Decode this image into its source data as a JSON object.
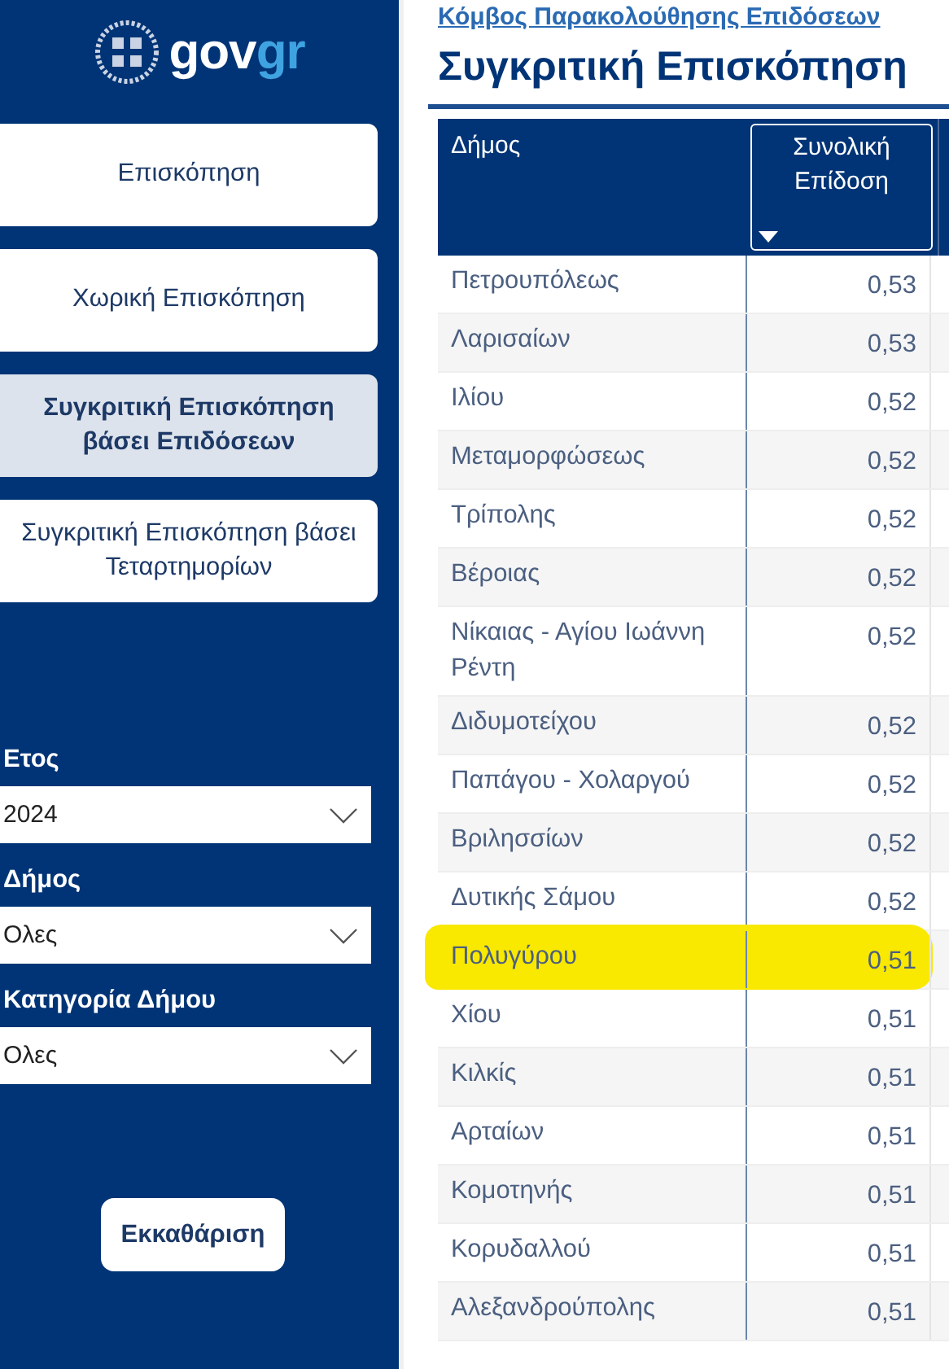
{
  "sidebar": {
    "logo": {
      "part_1": "gov",
      "part_2": "gr"
    },
    "nav": [
      {
        "label": "Επισκόπηση",
        "selected": false
      },
      {
        "label": "Χωρική Επισκόπηση",
        "selected": false
      },
      {
        "label": "Συγκριτική Επισκόπηση βάσει Επιδόσεων",
        "selected": true
      },
      {
        "label": "Συγκριτική Επισκόπηση βάσει Τεταρτημορίων",
        "selected": false
      }
    ],
    "filters": [
      {
        "label": "Ετος",
        "value": "2024"
      },
      {
        "label": "Δήμος",
        "value": "Ολες"
      },
      {
        "label": "Κατηγορία Δήμου",
        "value": "Ολες"
      }
    ],
    "clear_button": "Εκκαθάριση"
  },
  "breadcrumb": "Κόμβος Παρακολούθησης Επιδόσεων",
  "title": "Συγκριτική Επισκόπηση",
  "table": {
    "columns": [
      {
        "label": "Δήμος",
        "sorted": false
      },
      {
        "label": "Συνολική Επίδοση",
        "sorted": true
      }
    ],
    "rows": [
      {
        "name": "Πετρουπόλεως",
        "value": "0,53",
        "highlighted": false
      },
      {
        "name": "Λαρισαίων",
        "value": "0,53",
        "highlighted": false
      },
      {
        "name": "Ιλίου",
        "value": "0,52",
        "highlighted": false
      },
      {
        "name": "Μεταμορφώσεως",
        "value": "0,52",
        "highlighted": false
      },
      {
        "name": "Τρίπολης",
        "value": "0,52",
        "highlighted": false
      },
      {
        "name": "Βέροιας",
        "value": "0,52",
        "highlighted": false
      },
      {
        "name": "Νίκαιας - Αγίου Ιωάννη Ρέντη",
        "value": "0,52",
        "highlighted": false
      },
      {
        "name": "Διδυμοτείχου",
        "value": "0,52",
        "highlighted": false
      },
      {
        "name": "Παπάγου - Χολαργού",
        "value": "0,52",
        "highlighted": false
      },
      {
        "name": "Βριλησσίων",
        "value": "0,52",
        "highlighted": false
      },
      {
        "name": "Δυτικής Σάμου",
        "value": "0,52",
        "highlighted": false
      },
      {
        "name": "Πολυγύρου",
        "value": "0,51",
        "highlighted": true
      },
      {
        "name": "Χίου",
        "value": "0,51",
        "highlighted": false
      },
      {
        "name": "Κιλκίς",
        "value": "0,51",
        "highlighted": false
      },
      {
        "name": "Αρταίων",
        "value": "0,51",
        "highlighted": false
      },
      {
        "name": "Κομοτηνής",
        "value": "0,51",
        "highlighted": false
      },
      {
        "name": "Κορυδαλλού",
        "value": "0,51",
        "highlighted": false
      },
      {
        "name": "Αλεξανδρούπολης",
        "value": "0,51",
        "highlighted": false
      }
    ]
  }
}
